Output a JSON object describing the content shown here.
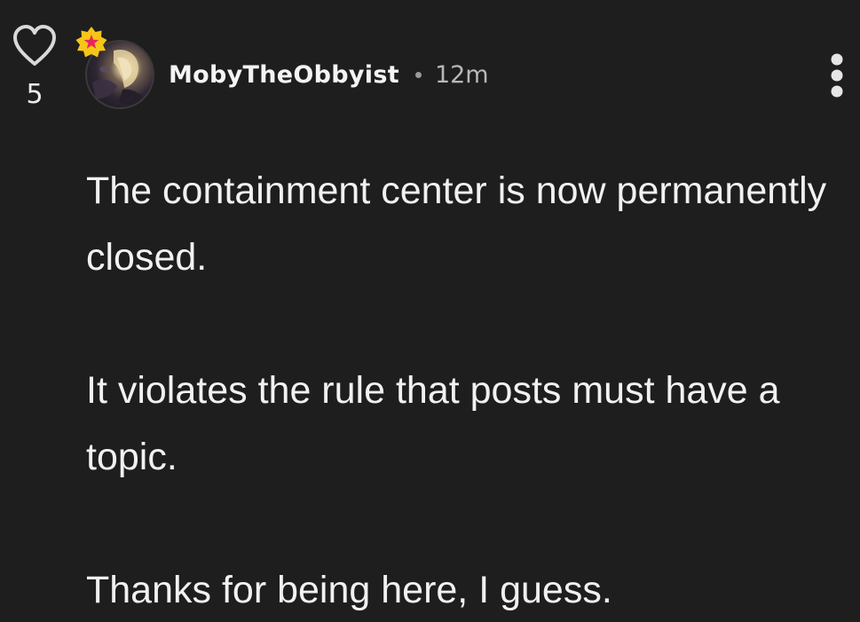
{
  "post": {
    "like_count": "5",
    "author": {
      "username": "MobyTheObbyist",
      "badge_icon": "star-badge-icon",
      "badge_color": "#f5c518",
      "badge_star_color": "#e8255a"
    },
    "timestamp": "12m",
    "paragraphs": [
      "The containment center is now permanently closed.",
      "It violates the rule that posts must have a topic.",
      "Thanks for being here, I guess."
    ]
  },
  "icons": {
    "like": "heart-outline-icon",
    "more": "more-vertical-icon"
  },
  "colors": {
    "background": "#1e1e1e",
    "text": "#f1f1f1",
    "muted": "#b8b8b8"
  }
}
